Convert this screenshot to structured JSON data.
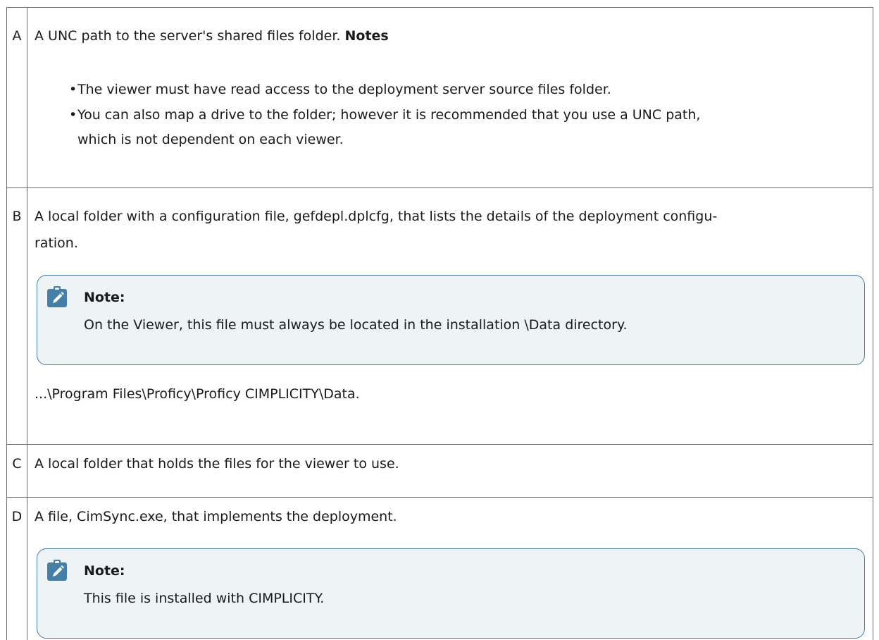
{
  "rows": [
    {
      "key": "A",
      "text": "A UNC path to the server's shared files folder.",
      "notes_title": "Notes",
      "bullets": [
        "The viewer must have read access to the deployment server source files folder.",
        "You can also map a drive to the folder; however it is recommended that you use a UNC path,",
        "which is not dependent on each viewer."
      ]
    },
    {
      "key": "B",
      "text_line1": "A local folder with a configuration file, gefdepl.dplcfg, that lists the details of the deployment configu-",
      "text_line2": "ration.",
      "note": {
        "title": "Note:",
        "text": "On the Viewer, this file must always be located in the installation \\Data directory."
      },
      "path": "...\\Program Files\\Proficy\\Proficy CIMPLICITY\\Data."
    },
    {
      "key": "C",
      "text": "A local folder that holds the files for the viewer to use."
    },
    {
      "key": "D",
      "text": "A file, CimSync.exe, that implements the deployment.",
      "note": {
        "title": "Note:",
        "text": "This file is installed with CIMPLICITY."
      }
    }
  ],
  "icons": {
    "note_icon": "pencil-clipboard-icon",
    "note_icon_color": "#447fa8"
  }
}
